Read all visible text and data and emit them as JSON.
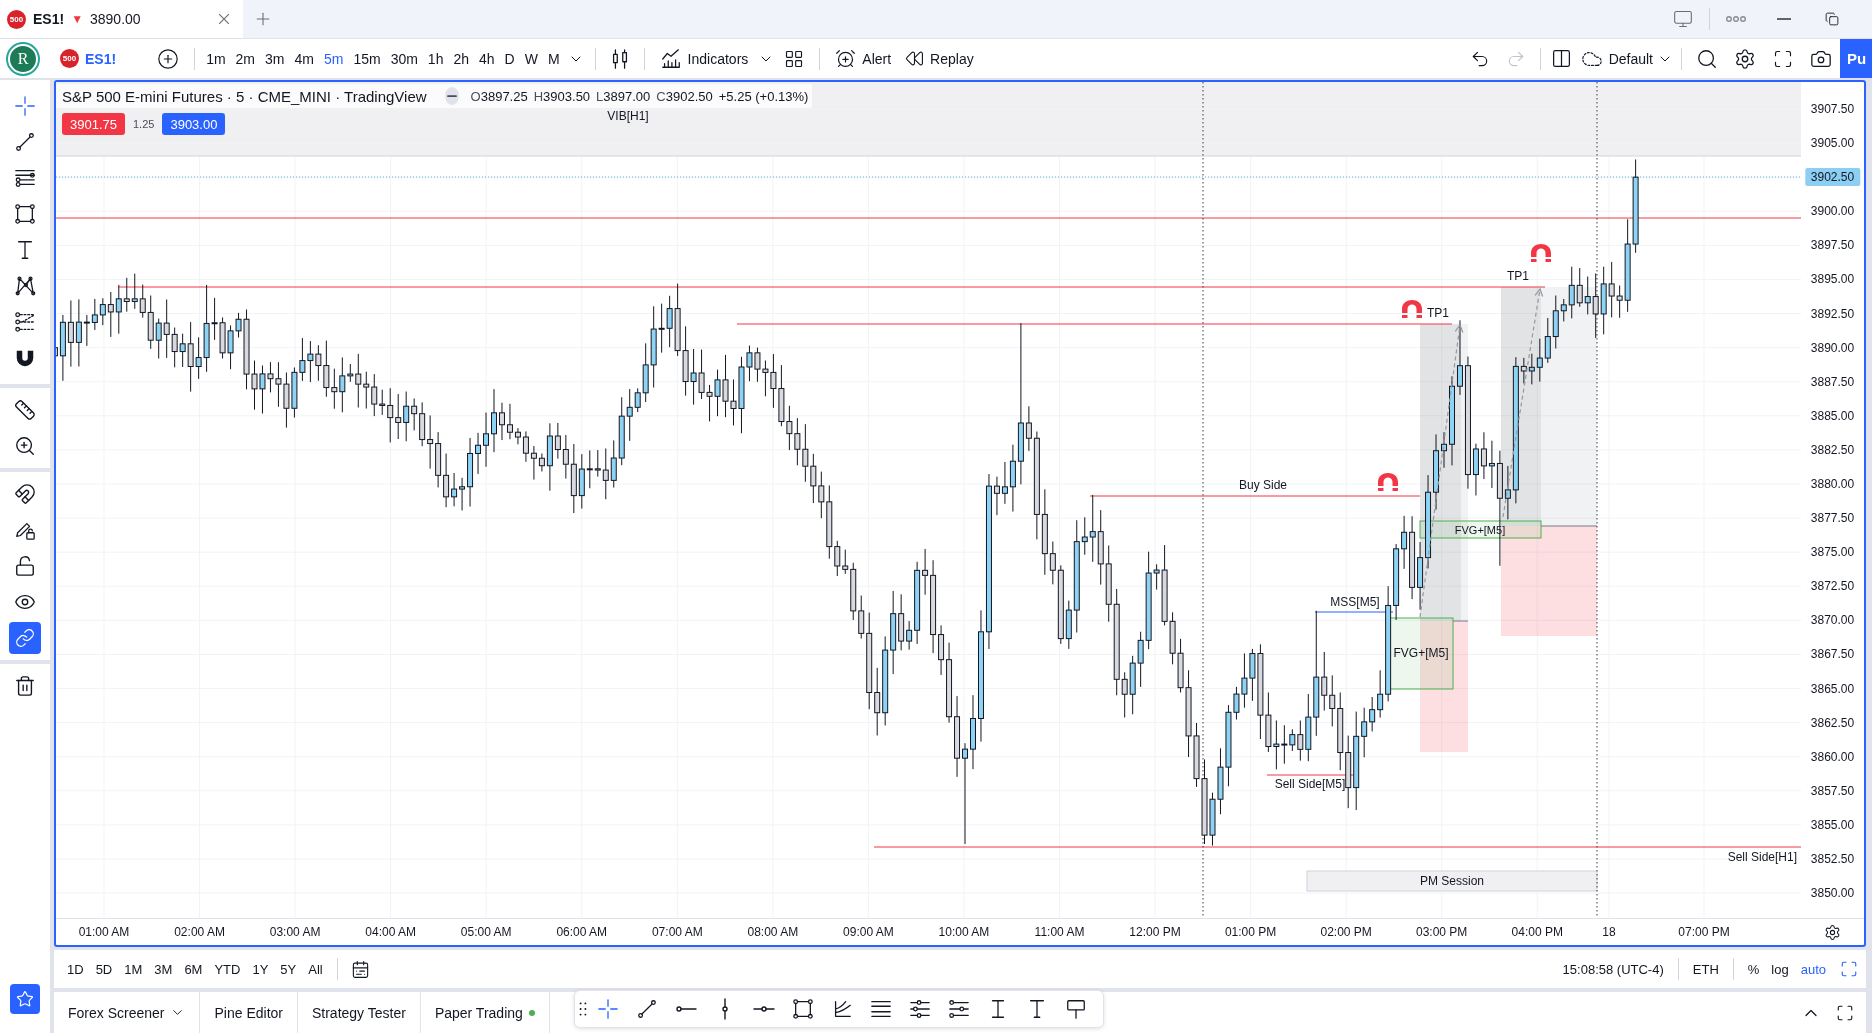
{
  "tab_bar": {
    "tab": {
      "logo_text": "500",
      "symbol": "ES1!",
      "change_marker": "▼",
      "price": "3890.00"
    }
  },
  "toolbar": {
    "avatar_letter": "R",
    "symbol": {
      "logo_text": "500",
      "name": "ES1!"
    },
    "intervals": [
      {
        "label": "1m",
        "selected": false
      },
      {
        "label": "2m",
        "selected": false
      },
      {
        "label": "3m",
        "selected": false
      },
      {
        "label": "4m",
        "selected": false
      },
      {
        "label": "5m",
        "selected": true
      },
      {
        "label": "15m",
        "selected": false
      },
      {
        "label": "30m",
        "selected": false
      },
      {
        "label": "1h",
        "selected": false
      },
      {
        "label": "2h",
        "selected": false
      },
      {
        "label": "4h",
        "selected": false
      },
      {
        "label": "D",
        "selected": false
      },
      {
        "label": "W",
        "selected": false
      },
      {
        "label": "M",
        "selected": false
      }
    ],
    "indicators": "Indicators",
    "alert": "Alert",
    "replay": "Replay",
    "redo": {
      "disabled": true
    },
    "layout": "Default",
    "publish": "Pu"
  },
  "left_toolbar": {
    "groups": [
      {
        "tools": [
          {
            "selected": true
          },
          {
            "selected": false
          },
          {
            "selected": false
          },
          {
            "selected": false
          },
          {
            "selected": false
          },
          {
            "selected": false
          },
          {
            "selected": false
          },
          {
            "selected": false
          }
        ]
      },
      {
        "tools": [
          {
            "selected": false
          },
          {
            "selected": false
          }
        ]
      },
      {
        "tools": [
          {
            "selected": false
          },
          {
            "selected": false
          },
          {
            "selected": false
          },
          {
            "selected": false
          },
          {
            "selected": true
          }
        ]
      },
      {
        "tools": [
          {
            "selected": false
          }
        ]
      }
    ]
  },
  "chart": {
    "legend": {
      "title": "S&P 500 E-mini Futures · 5 · CME_MINI · TradingView",
      "ohlc": [
        {
          "label": "O",
          "value": "3897.25"
        },
        {
          "label": "H",
          "value": "3903.50"
        },
        {
          "label": "L",
          "value": "3897.00"
        },
        {
          "label": "C",
          "value": "3902.50"
        }
      ],
      "change": "+5.25 (+0.13%)",
      "sell_price": "3901.75",
      "spread": "1.25",
      "buy_price": "3903.00"
    },
    "labels": [
      "VIB[H1]",
      "TP1",
      "TP1",
      "Buy Side",
      "FVG+[M5]",
      "MSS[M5]",
      "FVG+[M5]",
      "Sell Side[M5]",
      "Sell Side[H1]",
      "PM Session"
    ],
    "price_axis": {
      "ticks": [
        {
          "label": "3907.50",
          "current": false
        },
        {
          "label": "3905.00",
          "current": false
        },
        {
          "label": "3902.50",
          "current": true
        },
        {
          "label": "3900.00",
          "current": false
        },
        {
          "label": "3897.50",
          "current": false
        },
        {
          "label": "3895.00",
          "current": false
        },
        {
          "label": "3892.50",
          "current": false
        },
        {
          "label": "3890.00",
          "current": false
        },
        {
          "label": "3887.50",
          "current": false
        },
        {
          "label": "3885.00",
          "current": false
        },
        {
          "label": "3882.50",
          "current": false
        },
        {
          "label": "3880.00",
          "current": false
        },
        {
          "label": "3877.50",
          "current": false
        },
        {
          "label": "3875.00",
          "current": false
        },
        {
          "label": "3872.50",
          "current": false
        },
        {
          "label": "3870.00",
          "current": false
        },
        {
          "label": "3867.50",
          "current": false
        },
        {
          "label": "3865.00",
          "current": false
        },
        {
          "label": "3862.50",
          "current": false
        },
        {
          "label": "3860.00",
          "current": false
        },
        {
          "label": "3857.50",
          "current": false
        },
        {
          "label": "3855.00",
          "current": false
        },
        {
          "label": "3852.50",
          "current": false
        },
        {
          "label": "3850.00",
          "current": false
        }
      ]
    },
    "time_axis": {
      "labels": [
        "01:00 AM",
        "02:00 AM",
        "03:00 AM",
        "04:00 AM",
        "05:00 AM",
        "06:00 AM",
        "07:00 AM",
        "08:00 AM",
        "09:00 AM",
        "10:00 AM",
        "11:00 AM",
        "12:00 PM",
        "01:00 PM",
        "02:00 PM",
        "03:00 PM",
        "04:00 PM",
        "18",
        "07:00 PM"
      ]
    }
  },
  "range_bar": {
    "ranges": [
      "1D",
      "5D",
      "1M",
      "3M",
      "6M",
      "YTD",
      "1Y",
      "5Y",
      "All"
    ],
    "clock": "15:08:58 (UTC-4)",
    "session": "ETH",
    "scale_options": [
      {
        "label": "%",
        "on": false
      },
      {
        "label": "log",
        "on": false
      },
      {
        "label": "auto",
        "on": true
      }
    ]
  },
  "bottom_panel": {
    "tabs": [
      {
        "label": "Forex Screener",
        "kind": "dropdown",
        "selected": false
      },
      {
        "label": "Pine Editor",
        "kind": "plain",
        "selected": false
      },
      {
        "label": "Strategy Tester",
        "kind": "plain",
        "selected": false
      },
      {
        "label": "Paper Trading",
        "kind": "status",
        "selected": false,
        "color": "#4caf50"
      }
    ],
    "drawing_tools": [
      {
        "selected": true
      },
      {
        "selected": false
      },
      {
        "selected": false
      },
      {
        "selected": false
      },
      {
        "selected": false
      },
      {
        "selected": false
      },
      {
        "selected": false
      },
      {
        "selected": false
      },
      {
        "selected": false
      },
      {
        "selected": false
      },
      {
        "selected": false
      },
      {
        "selected": false
      },
      {
        "selected": false
      }
    ]
  }
}
